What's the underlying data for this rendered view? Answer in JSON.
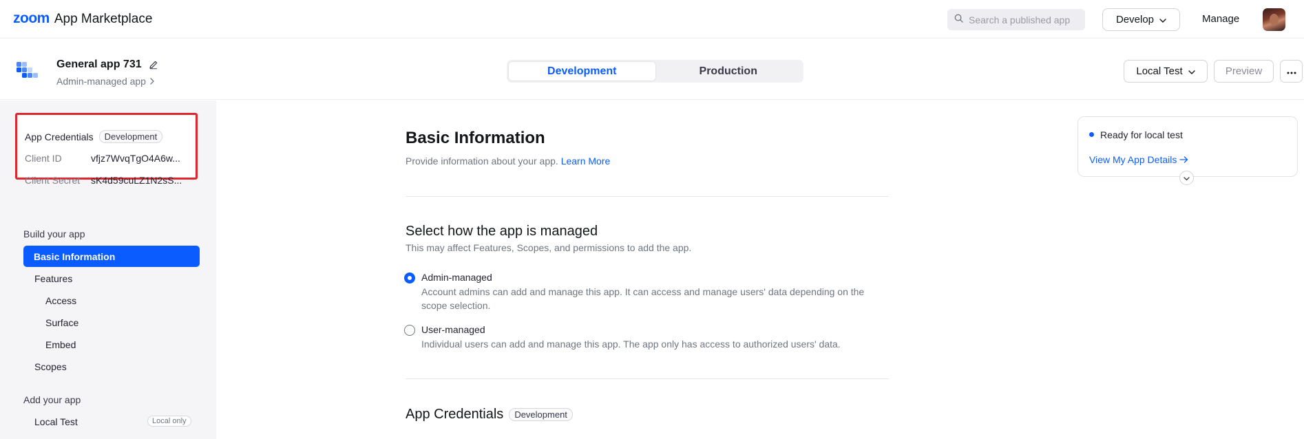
{
  "nav": {
    "logo_word": "zoom",
    "logo_text": "App Marketplace",
    "search_placeholder": "Search a published app",
    "develop_label": "Develop",
    "manage_label": "Manage"
  },
  "app": {
    "name": "General app 731",
    "type": "Admin-managed app",
    "env_tabs": [
      "Development",
      "Production"
    ],
    "local_test_label": "Local Test",
    "preview_label": "Preview"
  },
  "sidebar": {
    "credentials": {
      "title": "App Credentials",
      "badge": "Development",
      "client_id_label": "Client ID",
      "client_id_value": "vfjz7WvqTgO4A6w...",
      "client_secret_label": "Client Secret",
      "client_secret_value": "sK4d59cuLZ1N2sS..."
    },
    "build_section": "Build your app",
    "items": {
      "basic_information": "Basic Information",
      "features": "Features",
      "access": "Access",
      "surface": "Surface",
      "embed": "Embed",
      "scopes": "Scopes"
    },
    "add_section": "Add your app",
    "local_test": "Local Test",
    "local_only_badge": "Local only"
  },
  "main": {
    "title": "Basic Information",
    "subtitle": "Provide information about your app.",
    "learn_more": "Learn More",
    "manage_title": "Select how the app is managed",
    "manage_subtitle": "This may affect Features, Scopes, and permissions to add the app.",
    "options": [
      {
        "label": "Admin-managed",
        "desc": "Account admins can add and manage this app. It can access and manage users' data depending on the scope selection.",
        "checked": true
      },
      {
        "label": "User-managed",
        "desc": "Individual users can add and manage this app. The app only has access to authorized users' data.",
        "checked": false
      }
    ],
    "credentials_title": "App Credentials",
    "credentials_badge": "Development"
  },
  "status": {
    "text": "Ready for local test",
    "link": "View My App Details"
  },
  "colors": {
    "accent": "#0b5cff",
    "highlight_border": "#e0262e",
    "sidebar_bg": "#f5f5f7"
  }
}
